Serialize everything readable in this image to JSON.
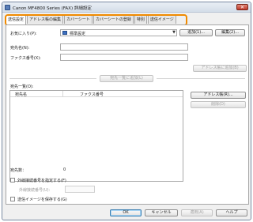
{
  "window": {
    "title": "Canon MF4800 Series (FAX) 詳細設定"
  },
  "tabs": [
    {
      "label": "送信設定"
    },
    {
      "label": "アドレス帳の編集"
    },
    {
      "label": "カバーシート"
    },
    {
      "label": "カバーシートの登録"
    },
    {
      "label": "特別"
    },
    {
      "label": "送信イメージ"
    }
  ],
  "favorites": {
    "label": "お気に入り(P):",
    "selected": "標準設定",
    "add_button": "追加(1)...",
    "edit_button": "編集(2)..."
  },
  "recipient": {
    "name_label": "宛先名(N):",
    "fax_label": "ファクス番号(X):",
    "add_addressbook_button": "アドレス帳に追加(B)"
  },
  "add_to_list_button": "宛先一覧に追加(L)",
  "list": {
    "label": "宛先一覧(O):",
    "columns": [
      "宛先名",
      "ファクス番号"
    ],
    "addressbook_button": "アドレス帳(R)...",
    "delete_button": "削除(D)"
  },
  "count": {
    "label": "宛先数：",
    "value": "0"
  },
  "external": {
    "checkbox_label": "外線接続番号を指定する(F)",
    "number_label": "外線接続番号(U):"
  },
  "save_image": {
    "checkbox_label": "送信イメージを保存する(G)"
  },
  "footer": {
    "ok": "OK",
    "cancel": "キャンセル",
    "apply": "適用(A)",
    "help": "ヘルプ"
  },
  "colors": {
    "highlight": "#f08a00",
    "close": "#c0392b",
    "accent": "#3d6fc0"
  }
}
